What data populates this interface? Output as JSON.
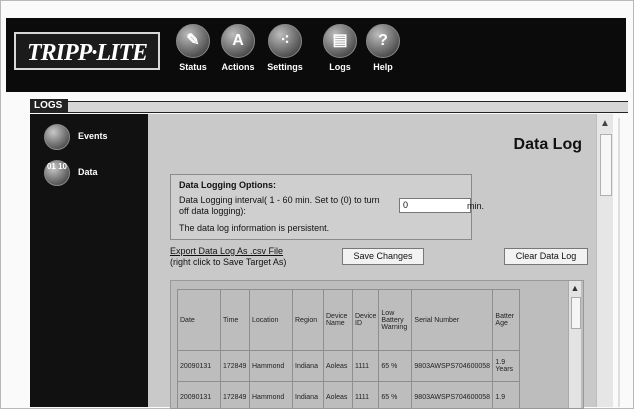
{
  "brand": {
    "logo_text": "TRIPP·LITE"
  },
  "nav": [
    {
      "label": "Status",
      "icon": "status-icon",
      "glyph": "✎"
    },
    {
      "label": "Actions",
      "icon": "actions-icon",
      "glyph": "A"
    },
    {
      "label": "Settings",
      "icon": "settings-icon",
      "glyph": "⁖"
    },
    {
      "label": "Logs",
      "icon": "logs-icon",
      "glyph": "▤"
    },
    {
      "label": "Help",
      "icon": "help-icon",
      "glyph": "?"
    }
  ],
  "section_title": "LOGS",
  "sidebar": {
    "items": [
      {
        "label": "Events",
        "icon": "events-icon",
        "glyph": ""
      },
      {
        "label": "Data",
        "icon": "data-icon",
        "glyph": "01 10"
      }
    ]
  },
  "page": {
    "title": "Data Log"
  },
  "options": {
    "title": "Data Logging Options:",
    "interval_desc": "Data Logging interval( 1 - 60 min. Set to (0) to turn off data logging):",
    "interval_value": "0",
    "unit": "min.",
    "note": "The data log information is persistent."
  },
  "export": {
    "link_text": "Export Data Log As .csv File",
    "hint": "(right click to Save Target As)"
  },
  "buttons": {
    "save": "Save Changes",
    "clear": "Clear Data Log"
  },
  "table": {
    "headers": [
      "Date",
      "Time",
      "Location",
      "Region",
      "Device Name",
      "Device ID",
      "Low Battery Warning",
      "Serial Number",
      "Batter Age"
    ],
    "rows": [
      [
        "20090131",
        "172849",
        "Hammond",
        "Indiana",
        "Aoleas",
        "1111",
        "65 %",
        "9803AWSPS704600058",
        "1.9 Years"
      ],
      [
        "20090131",
        "172849",
        "Hammond",
        "Indiana",
        "Aoleas",
        "1111",
        "65 %",
        "9803AWSPS704600058",
        "1.9"
      ]
    ]
  },
  "colors": {
    "topbar": "#0b0b0b",
    "sidebar": "#111111",
    "content_bg": "#c9c9c9"
  }
}
